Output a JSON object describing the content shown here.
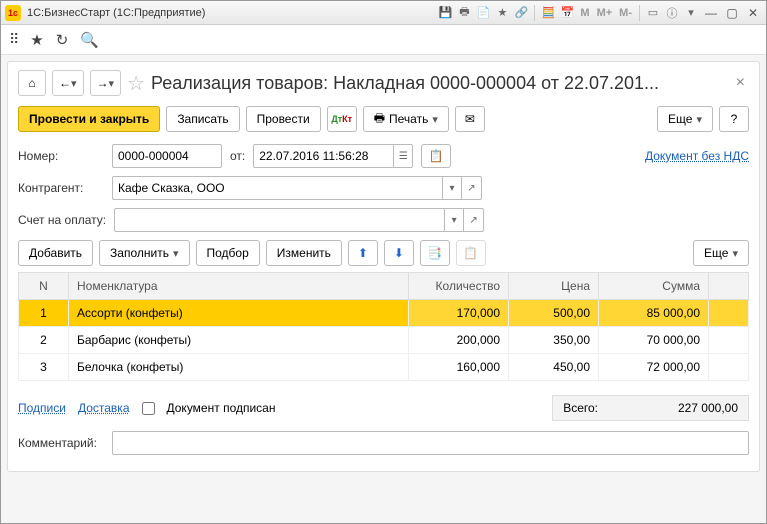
{
  "titlebar": {
    "title": "1С:БизнесСтарт  (1С:Предприятие)"
  },
  "header": {
    "doc_title": "Реализация товаров: Накладная 0000-000004 от 22.07.201..."
  },
  "actions": {
    "post_and_close": "Провести и закрыть",
    "save": "Записать",
    "post": "Провести",
    "print": "Печать",
    "more": "Еще"
  },
  "fields": {
    "number_label": "Номер:",
    "number_value": "0000-000004",
    "date_label": "от:",
    "date_value": "22.07.2016 11:56:28",
    "contractor_label": "Контрагент:",
    "contractor_value": "Кафе Сказка, ООО",
    "invoice_label": "Счет на оплату:",
    "invoice_value": "",
    "no_vat_link": "Документ без НДС",
    "comment_label": "Комментарий:"
  },
  "table_toolbar": {
    "add": "Добавить",
    "fill": "Заполнить",
    "pick": "Подбор",
    "edit": "Изменить",
    "more": "Еще"
  },
  "table": {
    "columns": {
      "n": "N",
      "item": "Номенклатура",
      "qty": "Количество",
      "price": "Цена",
      "sum": "Сумма"
    },
    "rows": [
      {
        "n": "1",
        "item": "Ассорти (конфеты)",
        "qty": "170,000",
        "price": "500,00",
        "sum": "85 000,00",
        "selected": true
      },
      {
        "n": "2",
        "item": "Барбарис (конфеты)",
        "qty": "200,000",
        "price": "350,00",
        "sum": "70 000,00",
        "selected": false
      },
      {
        "n": "3",
        "item": "Белочка (конфеты)",
        "qty": "160,000",
        "price": "450,00",
        "sum": "72 000,00",
        "selected": false
      }
    ]
  },
  "footer": {
    "signatures": "Подписи",
    "delivery": "Доставка",
    "signed_label": "Документ подписан",
    "total_label": "Всего:",
    "total_value": "227 000,00"
  }
}
